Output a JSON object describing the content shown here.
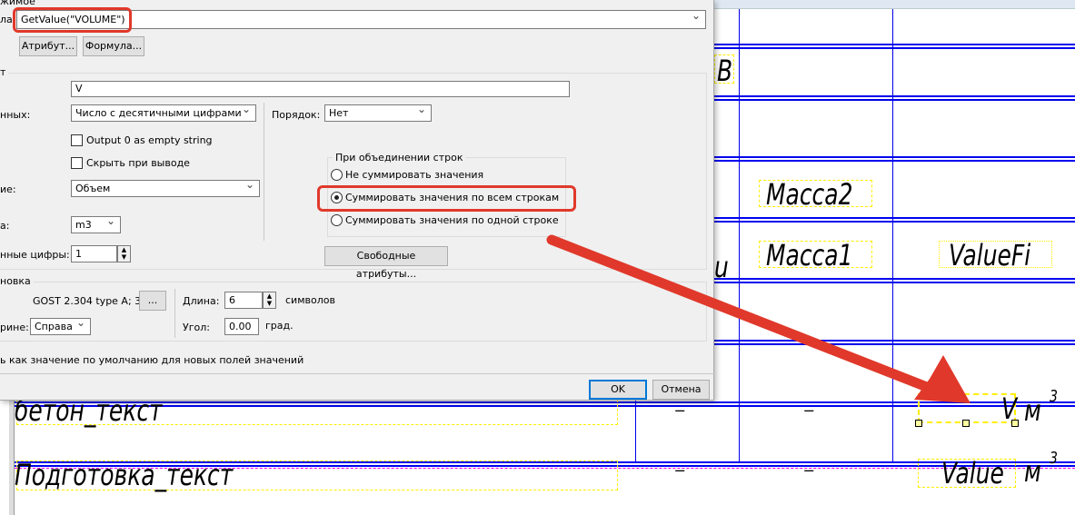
{
  "drawing": {
    "cells": {
      "b_letter": "В",
      "u_partial": "u",
      "mass2": "Масса2",
      "mass1": "Масса1",
      "value_fi": "ValueFi",
      "row1_name": "бетон_текст",
      "row1_col2": "–",
      "row1_col3": "–",
      "row1_value": "V",
      "row1_unit": "м",
      "row1_exp": "3",
      "row2_name": "Подготовка_текст",
      "row2_col2": "–",
      "row2_col3": "–",
      "row2_value": "Value",
      "row2_unit": "м",
      "row2_exp": "3"
    }
  },
  "dialog": {
    "top_group_label": "жимое",
    "formula_label": "ла:",
    "formula_value": "GetValue(\"VOLUME\")",
    "attribute_button": "Атрибут...",
    "formula_button": "Формула...",
    "format_group_label": "т",
    "name_value": "V",
    "datatype_label": "нных:",
    "datatype_value": "Число с десятичными цифрами",
    "order_label": "Порядок:",
    "order_value": "Нет",
    "output_zero_label": "Output 0 as empty string",
    "hide_label": "Скрыть при выводе",
    "quantity_label": "ие:",
    "quantity_value": "Объем",
    "unit_label": "а:",
    "unit_value": "m3",
    "decimals_label": "нные цифры:",
    "decimals_value": "1",
    "merge_group_label": "При объединении строк",
    "merge_options": [
      {
        "label": "Не суммировать значения",
        "selected": false
      },
      {
        "label": "Суммировать значения по всем строкам",
        "selected": true
      },
      {
        "label": "Суммировать значения по одной строке",
        "selected": false
      }
    ],
    "free_attributes_button": "Свободные атрибуты...",
    "text_group_label": "новка",
    "font_value": "GOST 2.304 type A; 3",
    "font_button": "...",
    "align_label": "рине:",
    "align_value": "Справа",
    "length_label": "Длина:",
    "length_value": "6",
    "length_unit": "символов",
    "angle_label": "Угол:",
    "angle_value": "0.00",
    "angle_unit": "град.",
    "default_checkbox_label": "ь как значение по умолчанию для новых полей значений",
    "ok_button": "OK",
    "cancel_button": "Отмена"
  },
  "colors": {
    "annotation": "#e0392b",
    "cad_line": "#0000ee",
    "frame": "#ffee00"
  }
}
